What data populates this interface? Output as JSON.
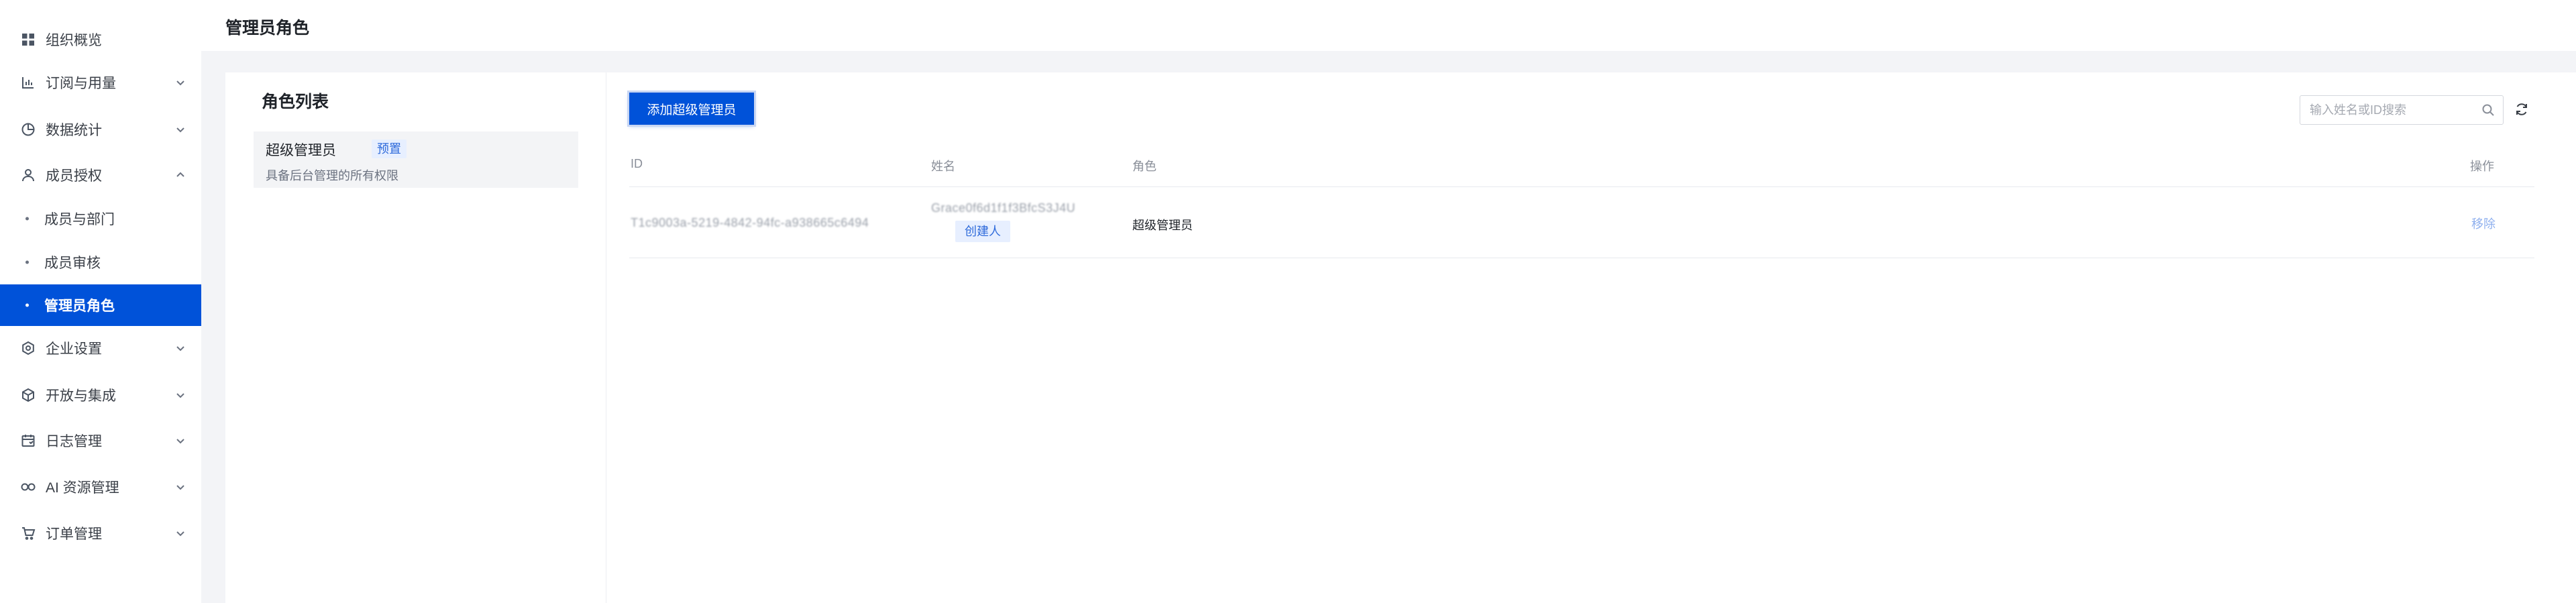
{
  "colors": {
    "accent": "#0052d9",
    "tag_bg": "#e7efff",
    "tag_text": "#2f6bdb",
    "page_bg": "#f3f4f7"
  },
  "sidebar": {
    "items": [
      {
        "label": "组织概览",
        "icon": "grid-icon"
      },
      {
        "label": "订阅与用量",
        "icon": "bar-chart-icon"
      },
      {
        "label": "数据统计",
        "icon": "pie-chart-icon"
      },
      {
        "label": "成员授权",
        "icon": "user-icon"
      },
      {
        "label": "企业设置",
        "icon": "settings-icon"
      },
      {
        "label": "开放与集成",
        "icon": "cube-icon"
      },
      {
        "label": "日志管理",
        "icon": "calendar-icon"
      },
      {
        "label": "AI 资源管理",
        "icon": "infinity-icon"
      },
      {
        "label": "订单管理",
        "icon": "cart-icon"
      }
    ],
    "sub_items": [
      {
        "label": "成员与部门"
      },
      {
        "label": "成员审核"
      },
      {
        "label": "管理员角色"
      }
    ]
  },
  "header": {
    "title": "管理员角色"
  },
  "role_list": {
    "title": "角色列表",
    "roles": [
      {
        "name": "超级管理员",
        "tag": "预置",
        "description": "具备后台管理的所有权限"
      }
    ]
  },
  "toolbar": {
    "add_button_label": "添加超级管理员",
    "search_placeholder": "输入姓名或ID搜索"
  },
  "table": {
    "columns": [
      "ID",
      "姓名",
      "角色",
      "操作"
    ],
    "rows": [
      {
        "id": "T1c9003a-5219-4842-94fc-a938665c6494",
        "name": "Grace0f6d1f1f3BfcS3J4U",
        "name_tag": "创建人",
        "role": "超级管理员",
        "action": "移除"
      }
    ]
  }
}
